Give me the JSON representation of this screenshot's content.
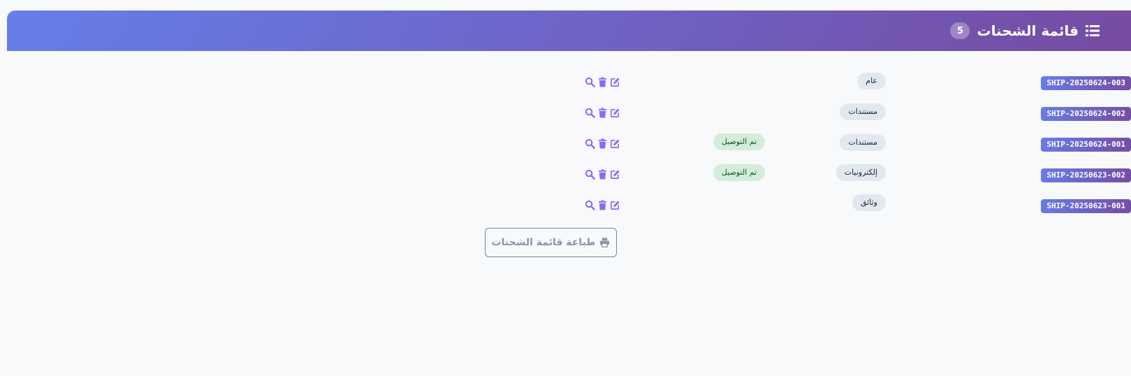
{
  "header": {
    "title": "قائمة الشحنات",
    "count": "5",
    "icon": "list-icon"
  },
  "colors": {
    "gradient_start": "#667eea",
    "gradient_end": "#764ba2",
    "action_icon": "#8b6cf0",
    "status_bg": "#d4edda",
    "status_text": "#155724",
    "category_bg": "#e2e8f0"
  },
  "shipments": [
    {
      "id": "SHIP-20250624-003",
      "category": "عام",
      "status": ""
    },
    {
      "id": "SHIP-20250624-002",
      "category": "مستندات",
      "status": ""
    },
    {
      "id": "SHIP-20250624-001",
      "category": "مستندات",
      "status": "تم التوصيل"
    },
    {
      "id": "SHIP-20250623-002",
      "category": "إلكترونيات",
      "status": "تم التوصيل"
    },
    {
      "id": "SHIP-20250623-001",
      "category": "وثائق",
      "status": ""
    }
  ],
  "row_actions": [
    "edit-icon",
    "delete-icon",
    "search-icon"
  ],
  "print_button": {
    "label": "طباعة قائمة الشحنات",
    "icon": "printer-icon"
  }
}
